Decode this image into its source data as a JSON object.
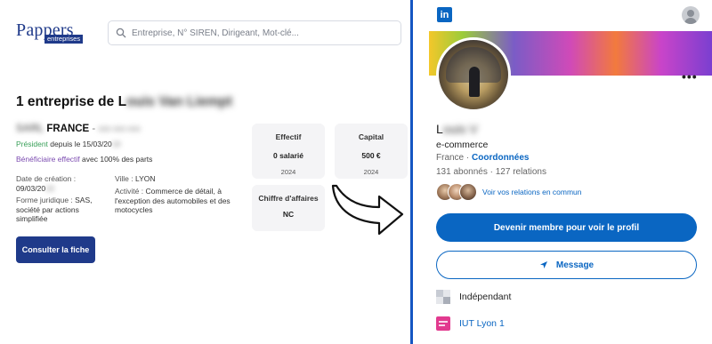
{
  "pappers": {
    "logo_main": "Pappers",
    "logo_sub": "entreprises",
    "search_placeholder": "Entreprise, N° SIREN, Dirigeant, Mot-clé...",
    "result_prefix": "1 entreprise de L",
    "result_name_blurred": "ouis Van Liempt",
    "company_blur_prefix": "SARL",
    "company_name": "FRANCE",
    "company_sep": " - ",
    "company_blur_suffix": "000 000 000",
    "role_label": "Président",
    "role_since": " depuis le 15/03/20",
    "role_year_blur": "19",
    "beneficiary_label": "Bénéficiaire effectif",
    "beneficiary_rest": " avec 100% des parts",
    "creation_label": "Date de création :",
    "creation_value": "09/03/20",
    "creation_year_blur": "19",
    "forme_label": "Forme juridique :",
    "forme_value": " SAS, société par actions simplifiée",
    "ville_label": "Ville :",
    "ville_value": " LYON",
    "activite_label": "Activité :",
    "activite_value": " Commerce de détail, à l'exception des automobiles et des motocycles",
    "consult_button": "Consulter la fiche",
    "cards": {
      "effectif": {
        "label": "Effectif",
        "value": "0 salarié",
        "year": "2024"
      },
      "capital": {
        "label": "Capital",
        "value": "500 €",
        "year": "2024"
      },
      "ca": {
        "label": "Chiffre d'affaires",
        "value": "NC"
      }
    }
  },
  "linkedin": {
    "logo_text": "in",
    "name_visible": "L",
    "name_blurred": "ouis V",
    "headline": "e-commerce",
    "location": "France",
    "location_sep": " · ",
    "contact_link": "Coordonnées",
    "followers": "131 abonnés",
    "conn_sep": " · ",
    "connections": "127 relations",
    "mutual_link": "Voir vos relations en commun",
    "primary_button": "Devenir membre pour voir le profil",
    "message_button": "Message",
    "experience": "Indépendant",
    "education": "IUT Lyon 1",
    "more_dots": "•••"
  },
  "colors": {
    "pappers_blue": "#1f3a8a",
    "linkedin_blue": "#0a66c2",
    "divider": "#1556c2",
    "president_green": "#3aa05a",
    "beneficiary_purple": "#7b4bb0"
  }
}
